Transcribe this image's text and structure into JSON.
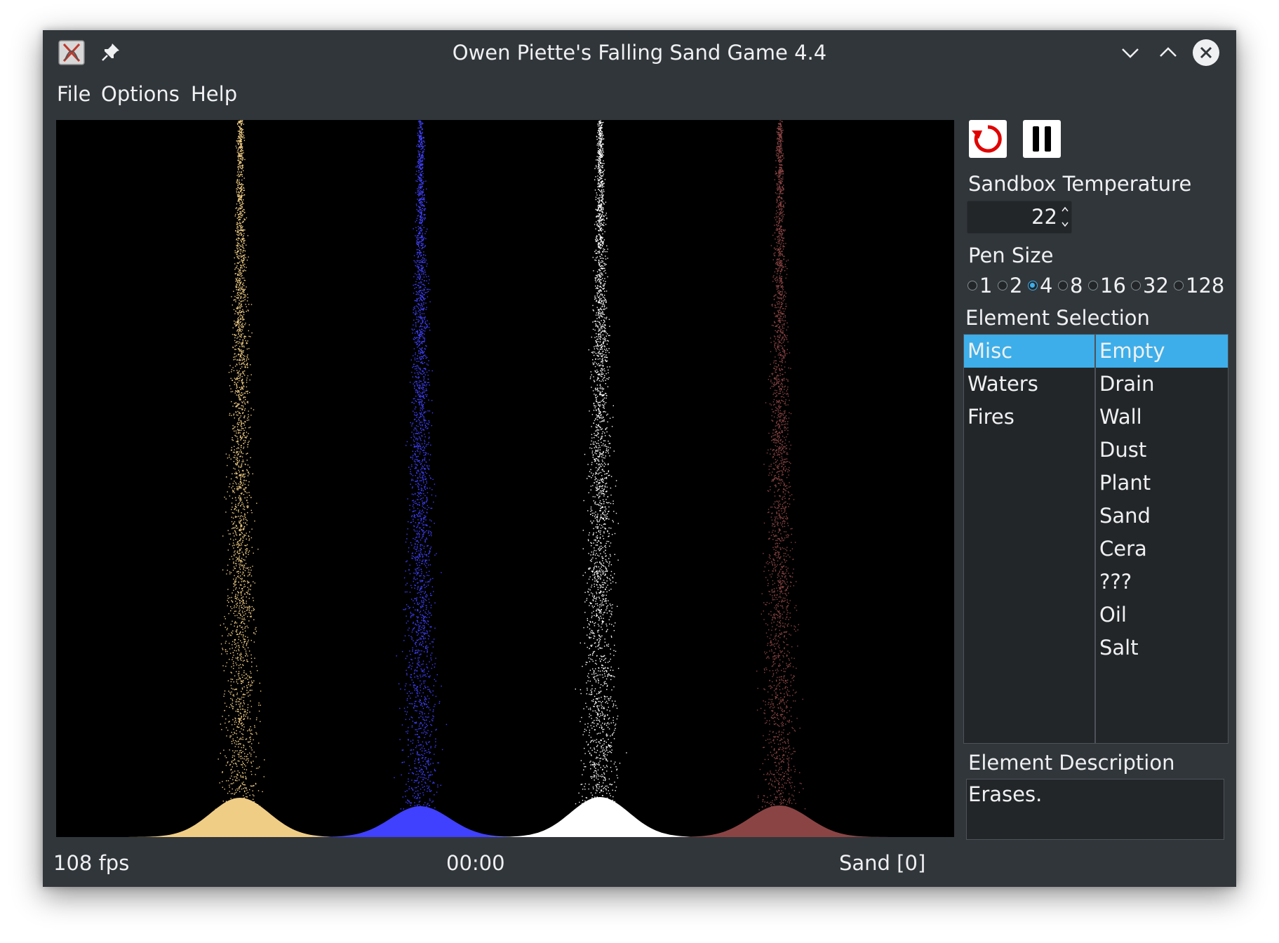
{
  "window": {
    "title": "Owen Piette's Falling Sand Game 4.4",
    "app_icon": "app-icon",
    "controls": [
      "minimize-chevron-icon",
      "maximize-chevron-icon",
      "close-icon"
    ]
  },
  "menu": {
    "file": "File",
    "options": "Options",
    "help": "Help"
  },
  "sandbox": {
    "particle_colors": [
      "#f0cd85",
      "#4040ff",
      "#ffffff",
      "#8b4444"
    ]
  },
  "toolbar": {
    "reset_icon": "reset-icon",
    "pause_icon": "pause-icon",
    "reset_color": "#e00000"
  },
  "temperature": {
    "label": "Sandbox Temperature",
    "value": "22"
  },
  "pen_size": {
    "label": "Pen Size",
    "options": [
      "1",
      "2",
      "4",
      "8",
      "16",
      "32",
      "128"
    ],
    "selected": "4"
  },
  "element_selection": {
    "label": "Element Selection",
    "categories": [
      "Misc",
      "Waters",
      "Fires"
    ],
    "selected_category": "Misc",
    "elements": [
      "Empty",
      "Drain",
      "Wall",
      "Dust",
      "Plant",
      "Sand",
      "Cera",
      "???",
      "Oil",
      "Salt"
    ],
    "selected_element": "Empty"
  },
  "description": {
    "label": "Element Description",
    "text": "Erases."
  },
  "status": {
    "fps": "108 fps",
    "time": "00:00",
    "element": "Sand [0]"
  },
  "colors": {
    "window_bg": "#31363b",
    "field_bg": "#232629",
    "accent": "#3daee9",
    "text": "#eff0f1"
  }
}
